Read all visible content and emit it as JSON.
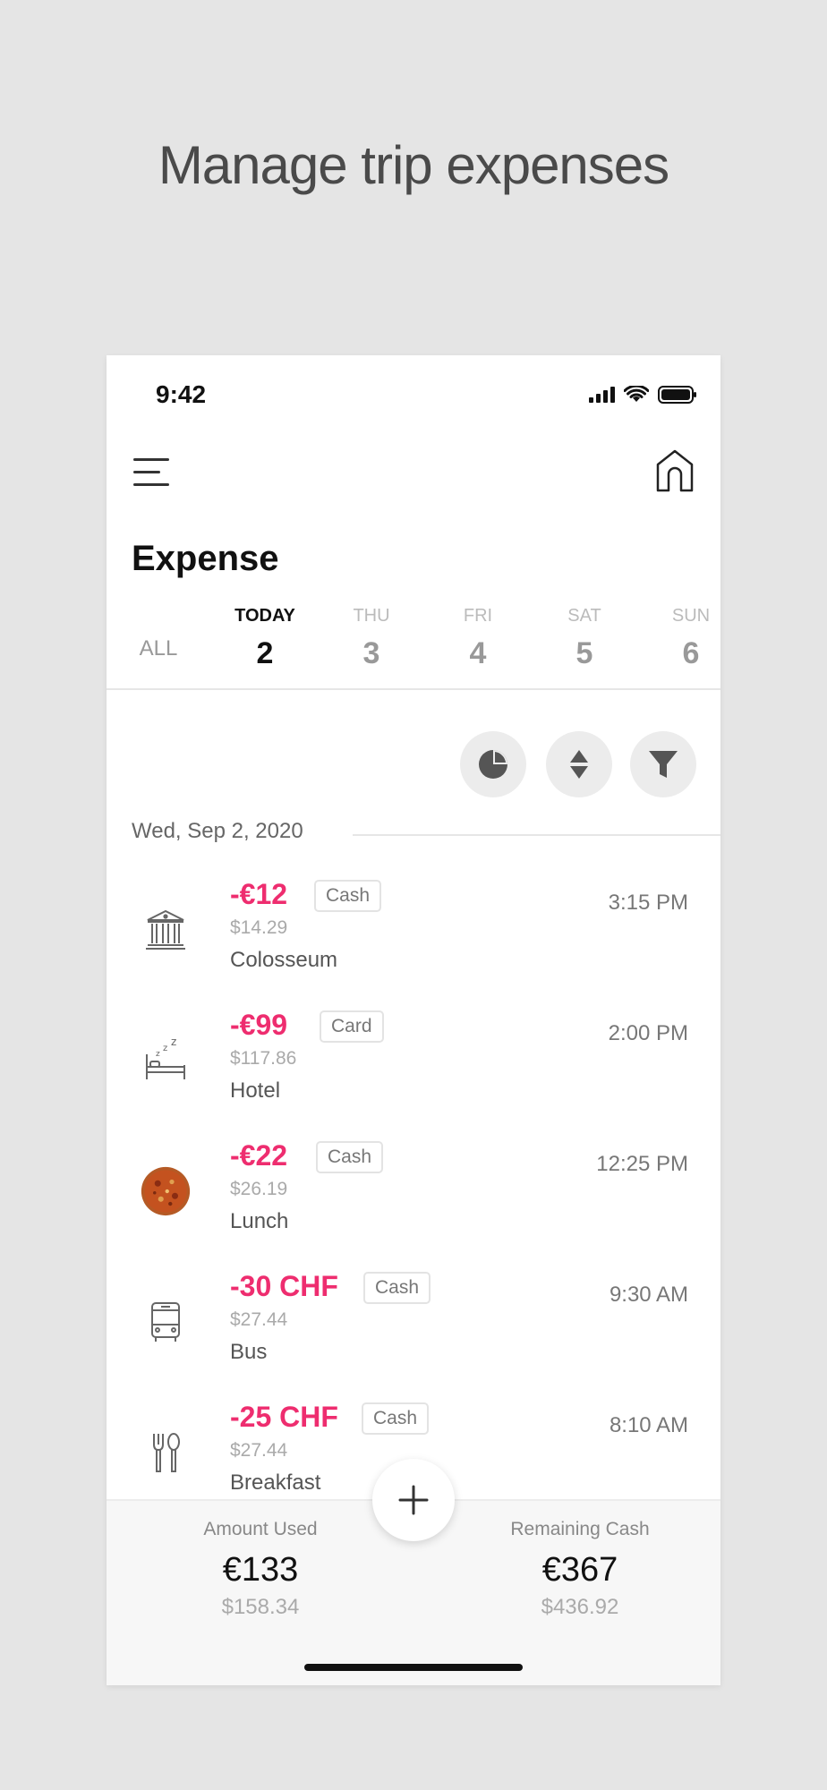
{
  "headline": "Manage trip expenses",
  "status_bar": {
    "time": "9:42"
  },
  "header": {
    "title": "Expense"
  },
  "tabs": [
    {
      "dow": "",
      "num": "ALL"
    },
    {
      "dow": "TODAY",
      "num": "2"
    },
    {
      "dow": "THU",
      "num": "3"
    },
    {
      "dow": "FRI",
      "num": "4"
    },
    {
      "dow": "SAT",
      "num": "5"
    },
    {
      "dow": "SUN",
      "num": "6"
    }
  ],
  "date_header": "Wed, Sep 2, 2020",
  "expenses": [
    {
      "icon": "museum-icon",
      "amount": "-€12",
      "method": "Cash",
      "usd": "$14.29",
      "name": "Colosseum",
      "time": "3:15 PM"
    },
    {
      "icon": "bed-icon",
      "amount": "-€99",
      "method": "Card",
      "usd": "$117.86",
      "name": "Hotel",
      "time": "2:00 PM"
    },
    {
      "icon": "pizza-photo",
      "amount": "-€22",
      "method": "Cash",
      "usd": "$26.19",
      "name": "Lunch",
      "time": "12:25 PM"
    },
    {
      "icon": "bus-icon",
      "amount": "-30 CHF",
      "method": "Cash",
      "usd": "$27.44",
      "name": "Bus",
      "time": "9:30 AM"
    },
    {
      "icon": "fork-spoon-icon",
      "amount": "-25 CHF",
      "method": "Cash",
      "usd": "$27.44",
      "name": "Breakfast",
      "time": "8:10 AM"
    }
  ],
  "summary": {
    "used": {
      "label": "Amount Used",
      "value": "€133",
      "sub": "$158.34"
    },
    "remaining": {
      "label": "Remaining Cash",
      "value": "€367",
      "sub": "$436.92"
    }
  },
  "colors": {
    "accent": "#ee2d6f",
    "text": "#111111",
    "muted": "#999999"
  }
}
